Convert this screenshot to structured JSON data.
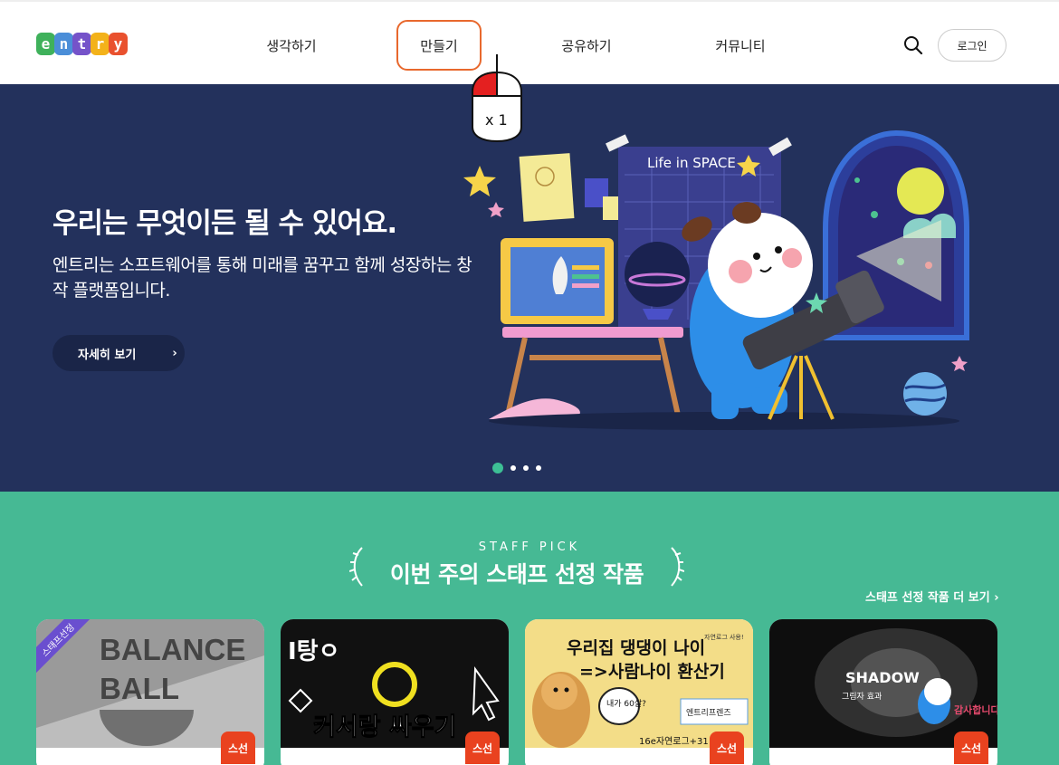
{
  "header": {
    "logo_letters": [
      "e",
      "n",
      "t",
      "r",
      "y"
    ],
    "logo_colors": [
      "#3fb15b",
      "#4b8ed8",
      "#7553c9",
      "#f3b21a",
      "#e9512e"
    ],
    "nav": [
      {
        "label": "생각하기"
      },
      {
        "label": "만들기",
        "active": true
      },
      {
        "label": "공유하기"
      },
      {
        "label": "커뮤니티"
      }
    ],
    "login_label": "로그인",
    "search_icon": "search-icon"
  },
  "mouse_overlay": {
    "click_count_label": "x 1",
    "button": "left"
  },
  "hero": {
    "title": "우리는 무엇이든 될 수 있어요.",
    "description": "엔트리는 소프트웨어를 통해 미래를 꿈꾸고 함께 성장하는 창작 플랫폼입니다.",
    "button_label": "자세히 보기",
    "button_arrow": "›",
    "poster_text": "Life in SPACE",
    "slides": 4,
    "active_slide": 1,
    "bg_color": "#23315c"
  },
  "staff_pick": {
    "kicker": "STAFF PICK",
    "title": "이번 주의 스태프 선정 작품",
    "more_label": "스태프 선정 작품 더 보기 ›",
    "bg_color": "#46b994",
    "cards": [
      {
        "thumb_text_1": "BALANCE",
        "thumb_text_2": "BALL",
        "ribbon": "스태프선정",
        "badge": "스선"
      },
      {
        "thumb_text_1": "I탕ㅇ",
        "thumb_text_2": "커서랑 싸우기",
        "badge": "스선"
      },
      {
        "thumb_text_1": "우리집 댕댕이 나이",
        "thumb_text_2": "=>사람나이 환산기",
        "bubble": "내가 60살?",
        "sticker": "엔트리프렌즈",
        "footer_text": "16e자연로그+31",
        "corner_text": "자연로그 사용!",
        "badge": "스선"
      },
      {
        "thumb_text_1": "SHADOW",
        "thumb_text_2": "그림자 효과",
        "speech": "감사합니다",
        "badge": "스선"
      }
    ]
  }
}
